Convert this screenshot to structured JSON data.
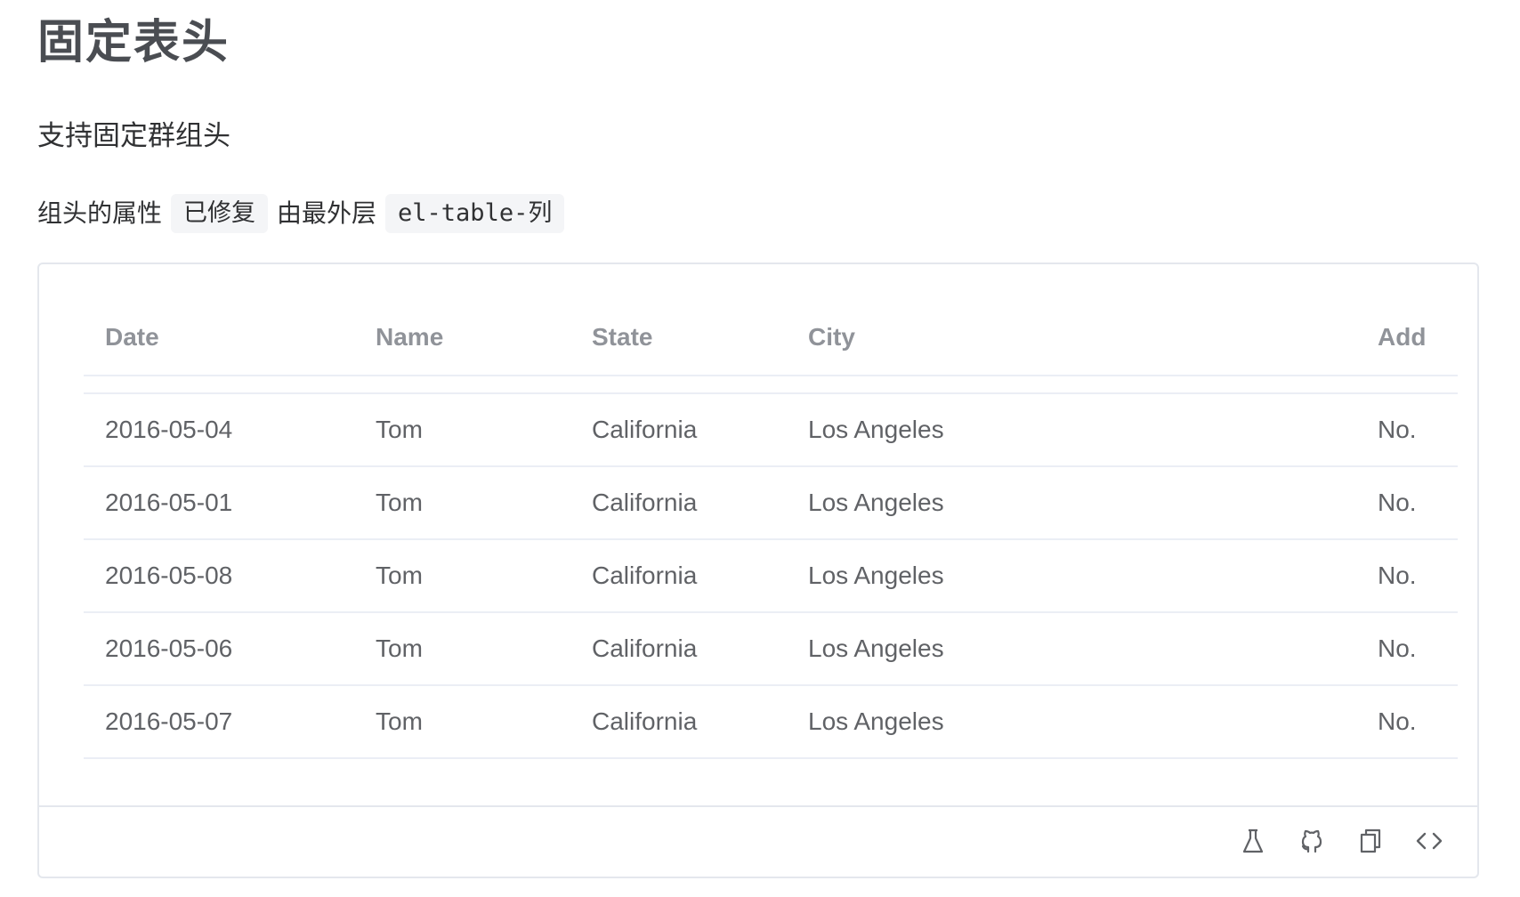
{
  "page": {
    "title": "固定表头",
    "subtitle": "支持固定群组头",
    "desc": {
      "prefix": "组头的属性",
      "code1": "已修复",
      "middle": "由最外层",
      "code2": "el-table-列"
    }
  },
  "table": {
    "headers": [
      "Date",
      "Name",
      "State",
      "City",
      "Add"
    ],
    "rows": [
      [
        "2016-05-04",
        "Tom",
        "California",
        "Los Angeles",
        "No."
      ],
      [
        "2016-05-01",
        "Tom",
        "California",
        "Los Angeles",
        "No."
      ],
      [
        "2016-05-08",
        "Tom",
        "California",
        "Los Angeles",
        "No."
      ],
      [
        "2016-05-06",
        "Tom",
        "California",
        "Los Angeles",
        "No."
      ],
      [
        "2016-05-07",
        "Tom",
        "California",
        "Los Angeles",
        "No."
      ]
    ]
  },
  "footer": {
    "icons": [
      "flask-icon",
      "github-icon",
      "copy-icon",
      "code-icon"
    ]
  },
  "colors": {
    "text": "#303133",
    "header_text": "#909399",
    "cell_text": "#606266",
    "border": "#ebeef5",
    "code_bg": "#f4f5f7",
    "icon": "#606266"
  }
}
